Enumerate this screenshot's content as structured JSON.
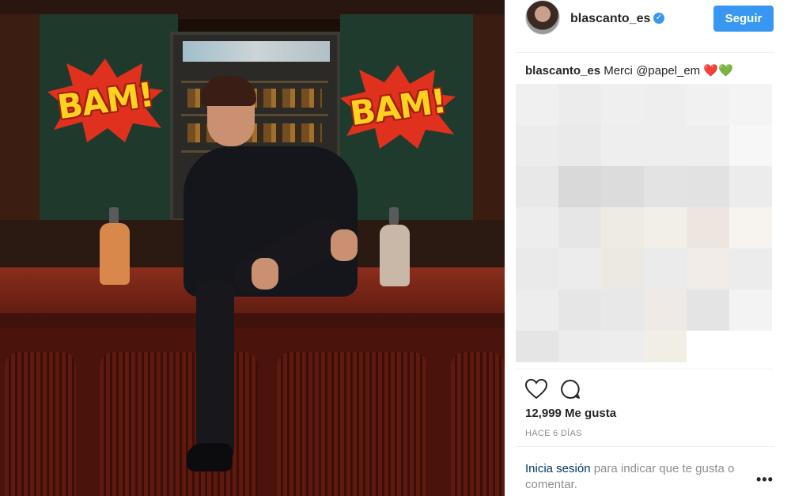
{
  "post": {
    "username": "blascanto_es",
    "verified_badge": "✓",
    "follow_label": "Seguir",
    "caption_user": "blascanto_es",
    "caption_text": "Merci",
    "caption_mention": "@papel_em",
    "caption_emoji": [
      "❤️",
      "💚"
    ],
    "likes": "12,999 Me gusta",
    "timestamp": "HACE 6 DÍAS",
    "login_link": "Inicia sesión",
    "login_text": "para indicar que te gusta o comentar.",
    "more": "•••"
  },
  "photo": {
    "signs": [
      "BAM!",
      "BAM!"
    ]
  },
  "icons": {
    "heart": "heart-outline-icon",
    "comment": "comment-bubble-icon",
    "more": "more-options-icon",
    "verified": "verified-badge-icon"
  },
  "colors": {
    "accent": "#3897f0",
    "link": "#003569",
    "muted": "#8e8e8e",
    "text": "#262626"
  },
  "blur_cells": [
    "#f0f0f0",
    "#ececec",
    "#efefef",
    "#eeeeee",
    "#f1f1f1",
    "#f4f4f4",
    "#ececec",
    "#eaeaea",
    "#eeeeee",
    "#eeeeee",
    "#eeeeee",
    "#f7f7f7",
    "#e8e8e8",
    "#d9d9d9",
    "#dcdcdc",
    "#e3e3e3",
    "#e2e2e2",
    "#ececec",
    "#ededed",
    "#e6e6e6",
    "#eeeae4",
    "#f2eee8",
    "#ede6e0",
    "#f7f4ef",
    "#eaeaea",
    "#ececec",
    "#ece9e2",
    "#ebebeb",
    "#f1ece8",
    "#ececec",
    "#ededed",
    "#e6e6e6",
    "#e8e8e8",
    "#efeae6",
    "#e4e4e4",
    "#f3f3f3",
    "#e5e5e5",
    "#ececec",
    "#ededed",
    "#f1eee6",
    "#ffffff",
    "#ffffff"
  ]
}
